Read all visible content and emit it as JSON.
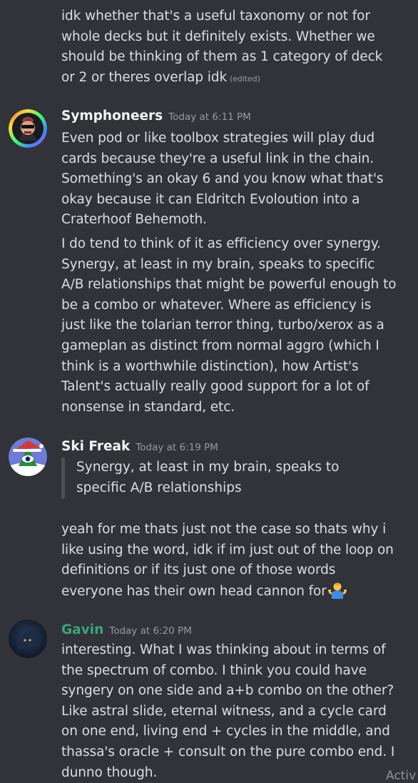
{
  "messages": [
    {
      "text": "idk whether that's a useful taxonomy or not for whole decks but it definitely exists. Whether we should be thinking of them as 1 category of deck or 2 or theres overlap idk",
      "edited_label": "(edited)"
    },
    {
      "username": "Symphoneers",
      "username_color": "#f2f3f5",
      "timestamp": "Today at 6:11 PM",
      "text_1": "Even pod or like toolbox strategies will play dud cards because they're a useful link in the chain. Something's an okay 6 and you know what that's okay because it can Eldritch Evoloution into a Craterhoof Behemoth.",
      "text_2": "I do tend to think of it as efficiency over synergy. Synergy, at least in my brain, speaks to specific A/B relationships that might be powerful enough to be a combo or whatever. Where as efficiency is just like the tolarian terror thing, turbo/xerox as a gameplan as distinct from normal aggro (which I think is a worthwhile distinction), how Artist's Talent's actually really good support for a lot of nonsense in standard, etc."
    },
    {
      "username": "Ski Freak",
      "username_color": "#f2f3f5",
      "timestamp": "Today at 6:19 PM",
      "quote": "Synergy, at least in my brain, speaks to specific A/B relationships",
      "text": "yeah for me thats just not the case so thats why i like using the word, idk if im just out of the loop on definitions or if its just one of those words everyone has their own head cannon for",
      "emoji": "person-shrugging-emoji"
    },
    {
      "username": "Gavin",
      "username_color": "#3ba57a",
      "timestamp": "Today at 6:20 PM",
      "text": "interesting. What I was thinking about in terms of the spectrum of combo. I think you could have syngery on one side and a+b combo on the other? Like astral slide, eternal witness, and a cycle card on one end, living end + cycles in the middle, and thassa's oracle + consult on the pure combo end. I dunno though."
    }
  ],
  "watermark": "Activ",
  "colors": {
    "background": "#313338",
    "text": "#dbdee1",
    "muted": "#949ba4",
    "gavin": "#3ba57a"
  }
}
